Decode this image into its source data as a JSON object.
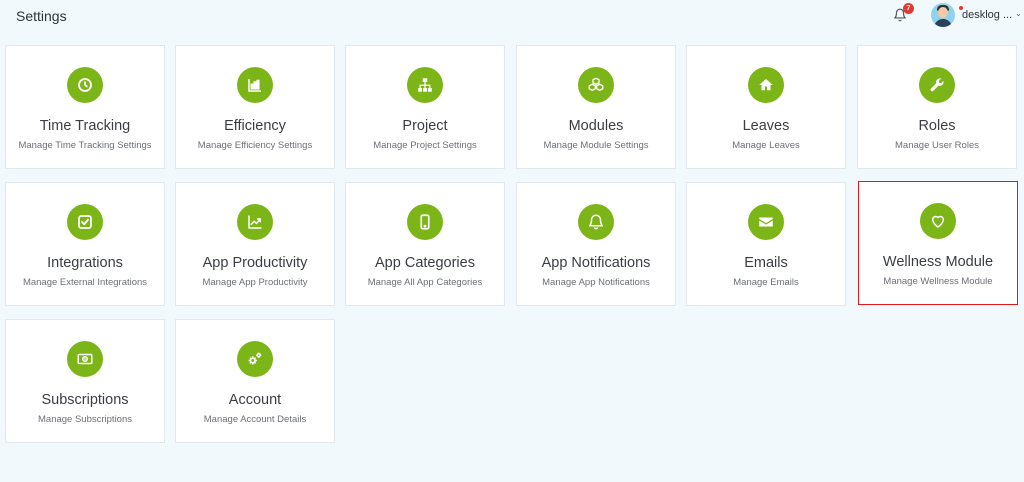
{
  "header": {
    "title": "Settings",
    "notification_count": "7",
    "user_name": "desklog ..."
  },
  "colors": {
    "accent": "#7cb518",
    "background": "#f1f9fd",
    "selected_border": "#e0191f",
    "badge": "#e53935"
  },
  "cards": [
    {
      "title": "Time Tracking",
      "subtitle": "Manage Time Tracking Settings",
      "icon": "clock-icon"
    },
    {
      "title": "Efficiency",
      "subtitle": "Manage Efficiency Settings",
      "icon": "bar-chart-icon"
    },
    {
      "title": "Project",
      "subtitle": "Manage Project Settings",
      "icon": "sitemap-icon"
    },
    {
      "title": "Modules",
      "subtitle": "Manage Module Settings",
      "icon": "cubes-icon"
    },
    {
      "title": "Leaves",
      "subtitle": "Manage Leaves",
      "icon": "home-icon"
    },
    {
      "title": "Roles",
      "subtitle": "Manage User Roles",
      "icon": "wrench-icon"
    },
    {
      "title": "Integrations",
      "subtitle": "Manage External Integrations",
      "icon": "check-square-icon"
    },
    {
      "title": "App Productivity",
      "subtitle": "Manage App Productivity",
      "icon": "line-chart-icon"
    },
    {
      "title": "App Categories",
      "subtitle": "Manage All App Categories",
      "icon": "mobile-icon"
    },
    {
      "title": "App Notifications",
      "subtitle": "Manage App Notifications",
      "icon": "bell-icon"
    },
    {
      "title": "Emails",
      "subtitle": "Manage Emails",
      "icon": "envelope-icon"
    },
    {
      "title": "Wellness Module",
      "subtitle": "Manage Wellness Module",
      "icon": "heart-icon",
      "selected": true
    },
    {
      "title": "Subscriptions",
      "subtitle": "Manage Subscriptions",
      "icon": "money-bill-icon"
    },
    {
      "title": "Account",
      "subtitle": "Manage Account Details",
      "icon": "gears-icon"
    }
  ]
}
